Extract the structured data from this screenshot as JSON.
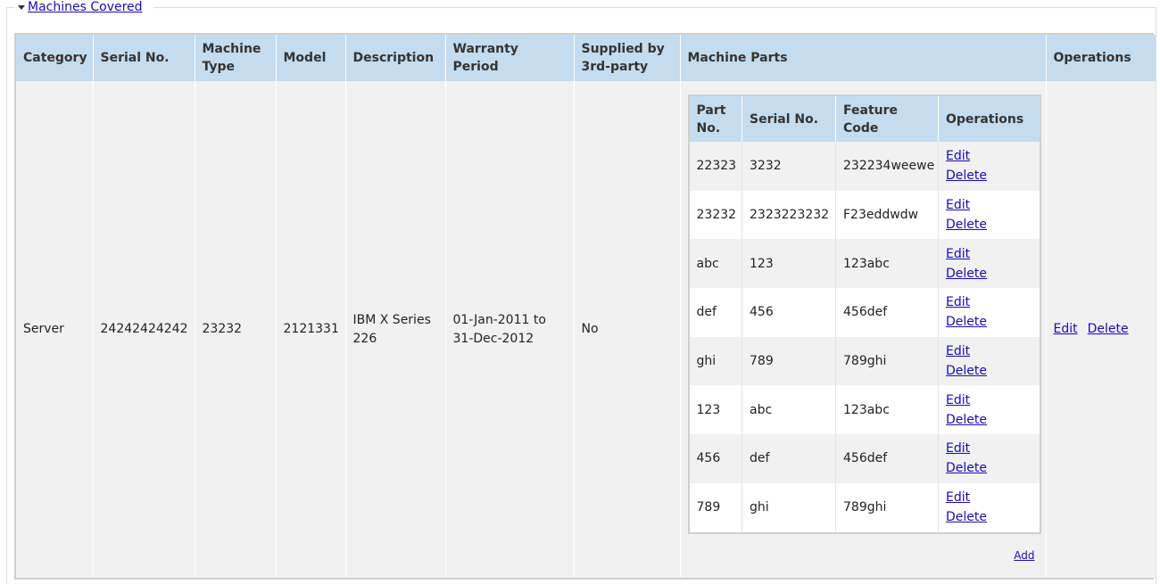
{
  "section": {
    "title": "Machines Covered"
  },
  "columns": {
    "category": "Category",
    "serial": "Serial No.",
    "machine_type": "Machine Type",
    "model": "Model",
    "description": "Description",
    "warranty": "Warranty Period",
    "supplied": "Supplied by 3rd-party",
    "parts": "Machine Parts",
    "operations": "Operations"
  },
  "machine": {
    "category": "Server",
    "serial": "24242424242",
    "machine_type": "23232",
    "model": "2121331",
    "description": "IBM X Series 226",
    "warranty": "01-Jan-2011 to 31-Dec-2012",
    "supplied": "No",
    "edit_label": "Edit",
    "delete_label": "Delete"
  },
  "parts_table": {
    "columns": {
      "part_no": "Part No.",
      "serial": "Serial No.",
      "feature_code": "Feature Code",
      "operations": "Operations"
    },
    "edit_label": "Edit",
    "delete_label": "Delete",
    "add_label": "Add",
    "rows": [
      {
        "part_no": "22323",
        "serial": "3232",
        "feature_code": "232234weewe"
      },
      {
        "part_no": "23232",
        "serial": "2323223232",
        "feature_code": "F23eddwdw"
      },
      {
        "part_no": "abc",
        "serial": "123",
        "feature_code": "123abc"
      },
      {
        "part_no": "def",
        "serial": "456",
        "feature_code": "456def"
      },
      {
        "part_no": "ghi",
        "serial": "789",
        "feature_code": "789ghi"
      },
      {
        "part_no": "123",
        "serial": "abc",
        "feature_code": "123abc"
      },
      {
        "part_no": "456",
        "serial": "def",
        "feature_code": "456def"
      },
      {
        "part_no": "789",
        "serial": "ghi",
        "feature_code": "789ghi"
      }
    ]
  }
}
